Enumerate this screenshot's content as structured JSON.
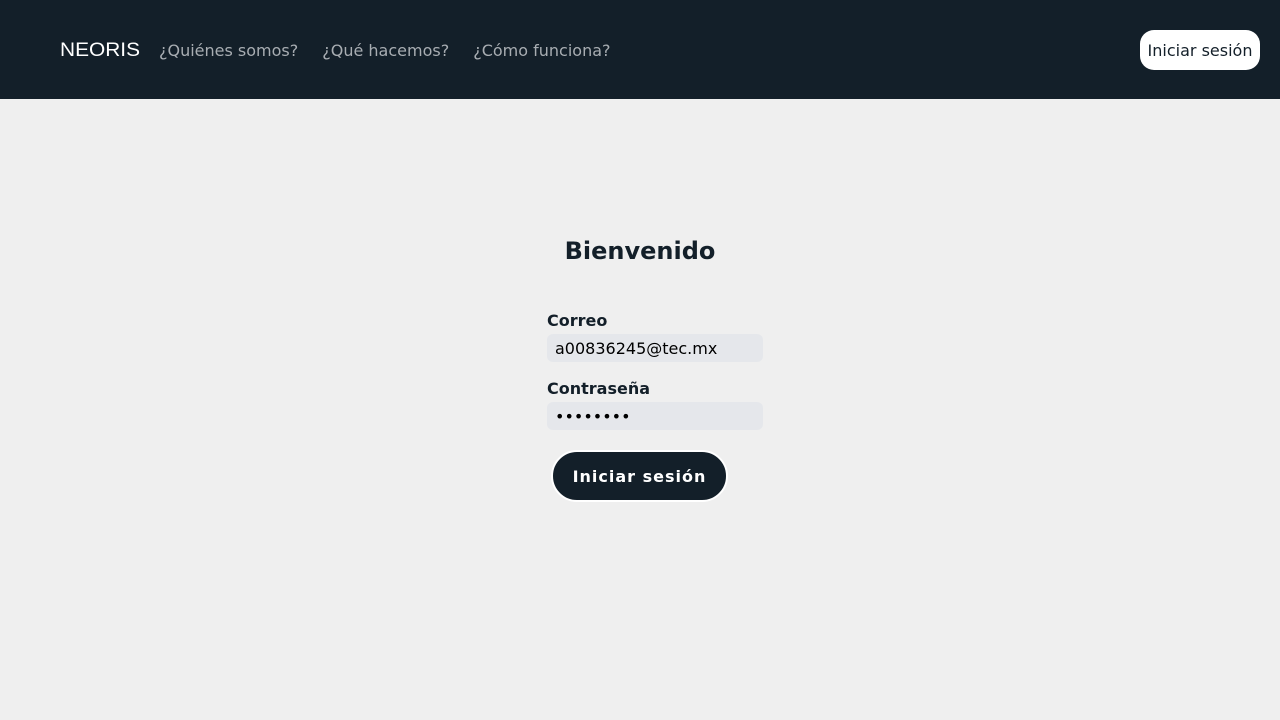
{
  "header": {
    "logo_text": "NEORIS",
    "nav": [
      {
        "label": "¿Quiénes somos?"
      },
      {
        "label": "¿Qué hacemos?"
      },
      {
        "label": "¿Cómo funciona?"
      }
    ],
    "login_label": "Iniciar sesión"
  },
  "form": {
    "title": "Bienvenido",
    "email": {
      "label": "Correo",
      "value": "a00836245@tec.mx"
    },
    "password": {
      "label": "Contraseña",
      "value": "password"
    },
    "submit_label": "Iniciar sesión"
  },
  "colors": {
    "navbar_bg": "#131f29",
    "page_bg": "#efefef",
    "input_bg": "#e5e7eb",
    "nav_link": "#a8adb2"
  }
}
